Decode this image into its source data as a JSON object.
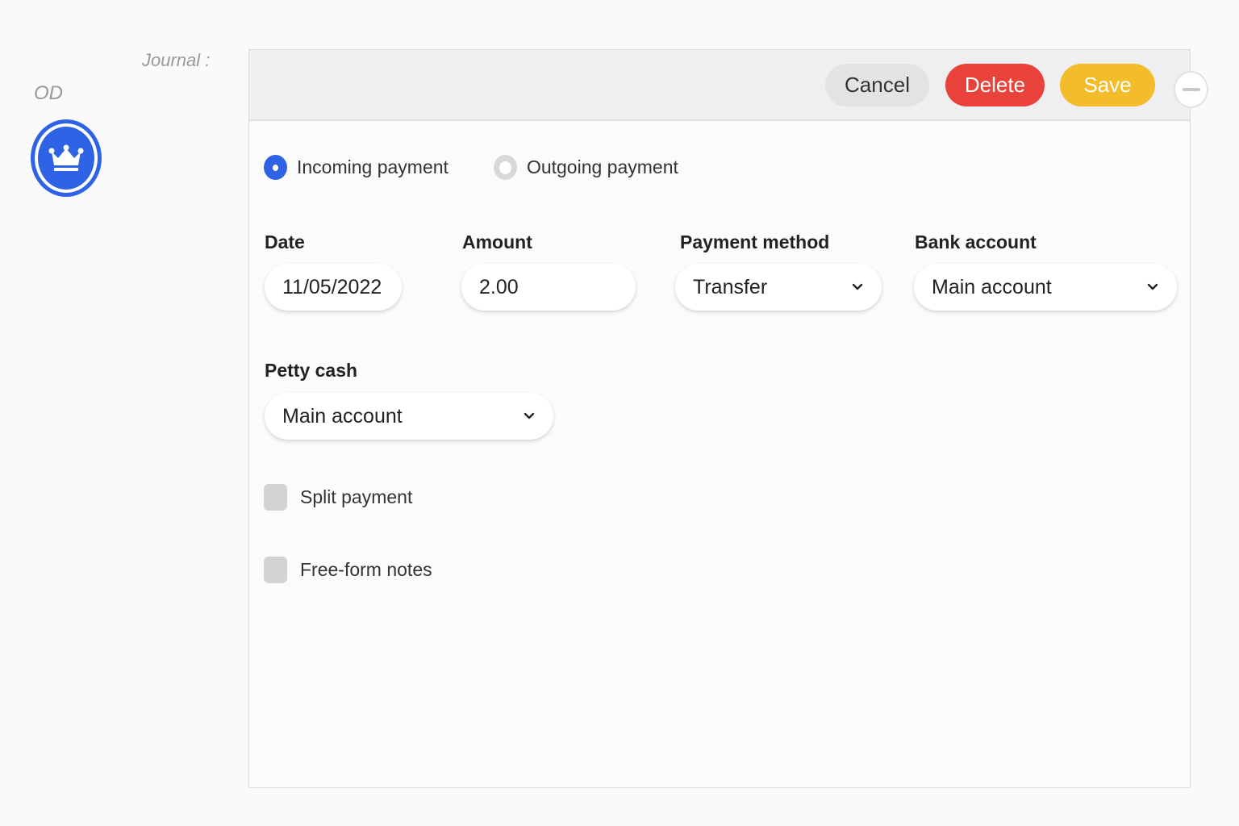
{
  "journal": {
    "label": "Journal :",
    "code": "OD"
  },
  "logo": {
    "icon": "crown-icon",
    "color": "#2e63e6"
  },
  "toolbar": {
    "cancel_label": "Cancel",
    "delete_label": "Delete",
    "save_label": "Save",
    "delete_color": "#e9423a",
    "save_color": "#f2bc2a"
  },
  "payment_type": {
    "incoming_label": "Incoming payment",
    "outgoing_label": "Outgoing payment",
    "selected": "incoming"
  },
  "fields": {
    "date": {
      "label": "Date",
      "value": "11/05/2022"
    },
    "amount": {
      "label": "Amount",
      "value": "2.00"
    },
    "payment_method": {
      "label": "Payment method",
      "value": "Transfer"
    },
    "bank_account": {
      "label": "Bank account",
      "value": "Main account"
    },
    "petty_cash": {
      "label": "Petty cash",
      "value": "Main account"
    }
  },
  "options": {
    "split_payment_label": "Split payment",
    "split_payment_checked": false,
    "free_form_notes_label": "Free-form notes",
    "free_form_notes_checked": false
  }
}
